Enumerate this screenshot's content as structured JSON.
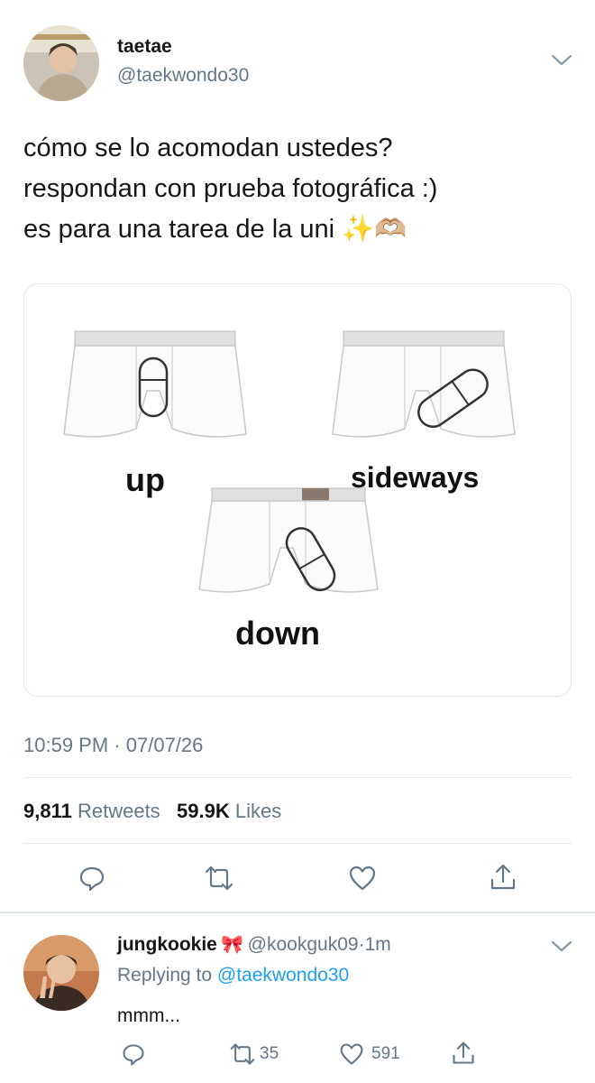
{
  "tweet": {
    "author_name": "taetae",
    "author_handle": "@taekwondo30",
    "text_lines": [
      "cómo se lo acomodan ustedes?",
      "respondan con prueba fotográfica :)",
      "es para una tarea de la uni"
    ],
    "emoji": "✨🫶🏼",
    "media_labels": {
      "up": "up",
      "sideways": "sideways",
      "down": "down"
    },
    "time": "10:59 PM",
    "date": "07/07/26",
    "separator": "·",
    "retweets_count": "9,811",
    "retweets_label": "Retweets",
    "likes_count": "59.9K",
    "likes_label": "Likes"
  },
  "actions": [
    "reply-icon",
    "retweet-icon",
    "like-icon",
    "share-icon"
  ],
  "reply": {
    "author_name": "jungkookie",
    "author_badge": "🎀",
    "author_handle": "@kookguk09",
    "time": "1m",
    "separator": "·",
    "replying_prefix": "Replying to",
    "replying_to": "@taekwondo30",
    "text": "mmm...",
    "retweets": "35",
    "likes": "591"
  },
  "colors": {
    "accent": "#1da1f2",
    "secondary_text": "#657786",
    "border": "#e1e8ed"
  }
}
